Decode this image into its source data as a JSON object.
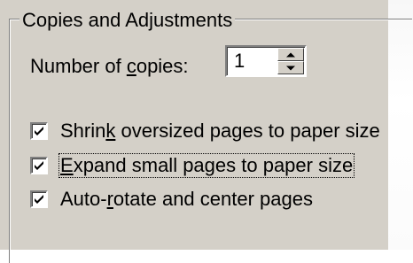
{
  "group": {
    "title": "Copies and Adjustments"
  },
  "copies": {
    "label_pre": "Number of ",
    "label_mnemonic": "c",
    "label_post": "opies:",
    "value": "1"
  },
  "options": [
    {
      "pre": "Shrin",
      "mnemonic": "k",
      "post": " oversized pages to paper size",
      "checked": true
    },
    {
      "pre": "",
      "mnemonic": "E",
      "post": "xpand small pages to paper size",
      "checked": true,
      "focused": true
    },
    {
      "pre": "Auto-",
      "mnemonic": "r",
      "post": "otate and center pages",
      "checked": true
    }
  ],
  "icons": {
    "check": "checkmark-icon",
    "spin_up": "chevron-up-icon",
    "spin_down": "chevron-down-icon"
  },
  "colors": {
    "panel": "#d4d0c8",
    "shadow": "#808080",
    "highlight": "#ffffff"
  }
}
